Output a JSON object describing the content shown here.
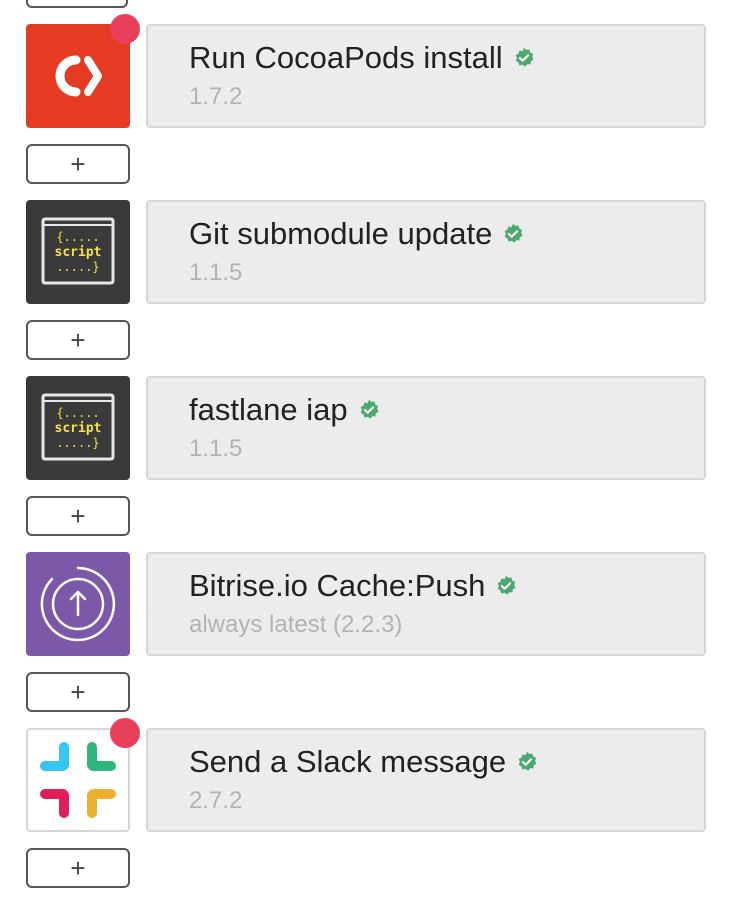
{
  "steps": [
    {
      "title": "Run CocoaPods install",
      "version": "1.7.2",
      "icon": "cocoapods-icon",
      "has_alert": true,
      "icon_bg": "#e63b23"
    },
    {
      "title": "Git submodule update",
      "version": "1.1.5",
      "icon": "script-icon",
      "has_alert": false,
      "icon_bg": "#3a3a3a"
    },
    {
      "title": "fastlane iap",
      "version": "1.1.5",
      "icon": "script-icon",
      "has_alert": false,
      "icon_bg": "#3a3a3a"
    },
    {
      "title": "Bitrise.io Cache:Push",
      "version": "always latest (2.2.3)",
      "icon": "cache-push-icon",
      "has_alert": false,
      "icon_bg": "#7b58a8"
    },
    {
      "title": "Send a Slack message",
      "version": "2.7.2",
      "icon": "slack-icon",
      "has_alert": true,
      "icon_bg": "#ffffff"
    }
  ],
  "add_label": "+",
  "script_icon_text": {
    "line1": "{.....",
    "line2": "script",
    "line3": ".....}"
  },
  "colors": {
    "verified": "#4aaa6e",
    "alert": "#e8405a",
    "card_bg": "#ececec"
  }
}
